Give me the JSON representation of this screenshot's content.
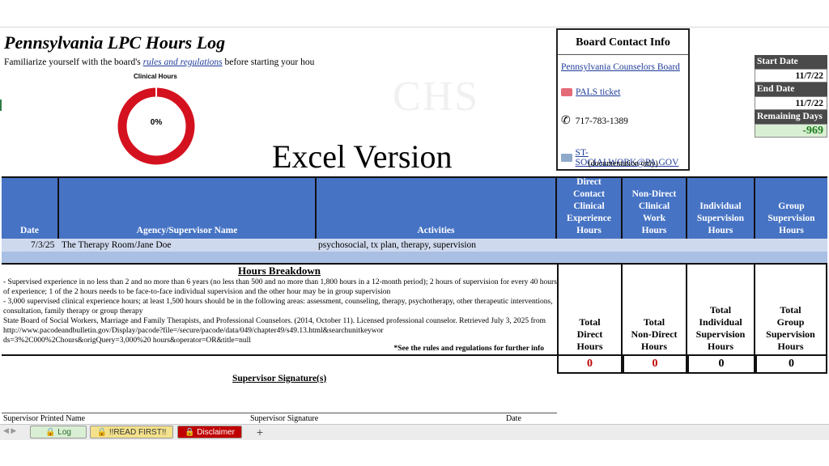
{
  "title": "Pennsylvania LPC Hours Log",
  "intro": {
    "prefix": "Familiarize yourself with the board's ",
    "link": "rules and regulations",
    "suffix": " before starting your hou"
  },
  "donut": {
    "title": "Clinical Hours",
    "percent_label": "0%",
    "progress": 0,
    "color": "#d4121f"
  },
  "watermark": "CHS",
  "excel_version": "Excel Version",
  "board": {
    "heading": "Board Contact Info",
    "link_board": "Pennsylvania Counselors Board",
    "link_pals": "PALS ticket",
    "phone": "717-783-1389",
    "email": "ST-SOCIALWORK@PA.GOV",
    "email_note": "(documentation only)"
  },
  "dates": {
    "start_label": "Start Date",
    "start_value": "11/7/22",
    "end_label": "End Date",
    "end_value": "11/7/22",
    "remaining_label": "Remaining Days",
    "remaining_value": "-969"
  },
  "table": {
    "headers": {
      "date": "Date",
      "agency": "Agency/Supervisor Name",
      "activities": "Activities",
      "direct": [
        "Direct",
        "Contact",
        "Clinical",
        "Experience",
        "Hours"
      ],
      "nondirect": [
        "Non-Direct",
        "Clinical",
        "Work",
        "Hours"
      ],
      "individual": [
        "Individual",
        "Supervision",
        "Hours"
      ],
      "group": [
        "Group",
        "Supervision",
        "Hours"
      ]
    },
    "row": {
      "date": "7/3/25",
      "agency": "The Therapy Room/Jane Doe",
      "activities": "psychosocial, tx plan, therapy, supervision"
    }
  },
  "breakdown": {
    "heading": "Hours Breakdown",
    "line1": "- Supervised experience in no less than 2 and no more than 6 years (no less than 500 and no more than 1,800 hours in a 12-month period); 2 hours of supervision for every 40 hours of experience; 1 of the 2 hours needs to be face-to-face individual supervision and the other hour may be in group supervision",
    "line2": "- 3,000 supervised clinical experience hours; at least 1,500 hours should be in the following areas: assessment, counseling, therapy, psychotherapy, other therapeutic interventions, consultation, family therapy or group therapy",
    "line3": "State Board of Social Workers, Marriage and Family Therapists, and Professional Counselors. (2014, October 11). Licensed professional counselor. Retrieved July 3, 2025 from",
    "line4": "http://www.pacodeandbulletin.gov/Display/pacode?file=/secure/pacode/data/049/chapter49/s49.13.html&searchunitkeywords=3%2C000%2Chours&origQuery=3,000%20 hours&operator=OR&title=null",
    "see_rules": "*See the rules and regulations for further info"
  },
  "totals": {
    "direct_label": [
      "Total",
      "Direct",
      "Hours"
    ],
    "nondirect_label": [
      "Total",
      "Non-Direct",
      "Hours"
    ],
    "individual_label": [
      "Total",
      "Individual",
      "Supervision",
      "Hours"
    ],
    "group_label": [
      "Total",
      "Group",
      "Supervision",
      "Hours"
    ],
    "direct_value": "0",
    "nondirect_value": "0",
    "individual_value": "0",
    "group_value": "0"
  },
  "supervisor_signatures": "Supervisor Signature(s)",
  "signature_labels": {
    "printed_name": "Supervisor Printed Name",
    "signature": "Supervisor Signature",
    "date": "Date"
  },
  "tabs": {
    "log": "Log",
    "read_first": "!!READ FIRST!!",
    "disclaimer": "Disclaimer",
    "add": "+"
  },
  "colors": {
    "header_blue": "#4673c4",
    "row_light": "#cfd9ee",
    "row_mid": "#a9bfe3",
    "total_red": "#c00000",
    "remaining_green": "#1b7e1b"
  }
}
